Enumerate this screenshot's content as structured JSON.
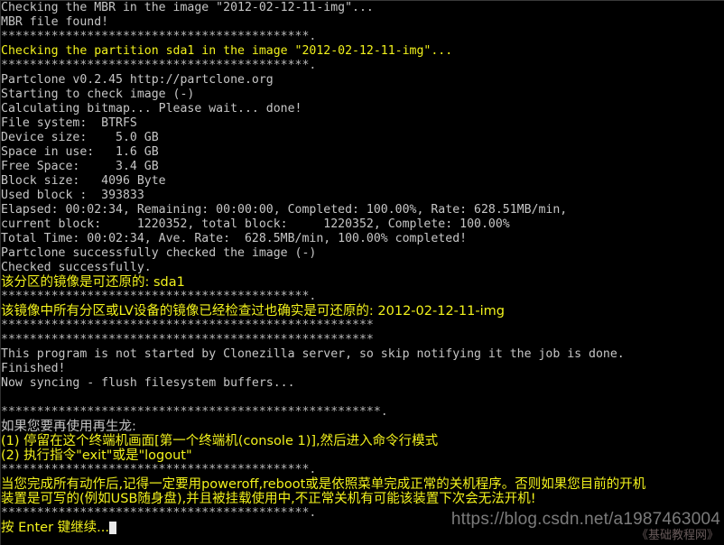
{
  "terminal": {
    "background_color": "#000000",
    "default_text_color": "#c6c6c6",
    "highlight_text_color": "#f2f21c",
    "cursor": "block-cursor",
    "separator_short": "*******************************************.",
    "separator_plain": "****************************************************",
    "separator_long": "*****************************************************.",
    "lines": [
      {
        "id": "l01",
        "color": "white",
        "text": "Checking the MBR in the image \"2012-02-12-11-img\"..."
      },
      {
        "id": "l02",
        "color": "white",
        "text": "MBR file found!"
      },
      {
        "id": "l03",
        "color": "stars",
        "text": "*******************************************."
      },
      {
        "id": "l04",
        "color": "yellow",
        "text": "Checking the partition sda1 in the image \"2012-02-12-11-img\"..."
      },
      {
        "id": "l05",
        "color": "stars",
        "text": "*******************************************."
      },
      {
        "id": "l06",
        "color": "white",
        "text": "Partclone v0.2.45 http://partclone.org"
      },
      {
        "id": "l07",
        "color": "white",
        "text": "Starting to check image (-)"
      },
      {
        "id": "l08",
        "color": "white",
        "text": "Calculating bitmap... Please wait... done!"
      },
      {
        "id": "l09",
        "color": "white",
        "text": "File system:  BTRFS"
      },
      {
        "id": "l10",
        "color": "white",
        "text": "Device size:    5.0 GB"
      },
      {
        "id": "l11",
        "color": "white",
        "text": "Space in use:   1.6 GB"
      },
      {
        "id": "l12",
        "color": "white",
        "text": "Free Space:     3.4 GB"
      },
      {
        "id": "l13",
        "color": "white",
        "text": "Block size:   4096 Byte"
      },
      {
        "id": "l14",
        "color": "white",
        "text": "Used block :  393833"
      },
      {
        "id": "l15",
        "color": "white",
        "text": "Elapsed: 00:02:34, Remaining: 00:00:00, Completed: 100.00%, Rate: 628.51MB/min,"
      },
      {
        "id": "l16",
        "color": "white",
        "text": "current block:     1220352, total block:     1220352, Complete: 100.00%"
      },
      {
        "id": "l17",
        "color": "white",
        "text": "Total Time: 00:02:34, Ave. Rate:  628.5MB/min, 100.00% completed!"
      },
      {
        "id": "l18",
        "color": "white",
        "text": "Partclone successfully checked the image (-)"
      },
      {
        "id": "l19",
        "color": "white",
        "text": "Checked successfully."
      },
      {
        "id": "l20",
        "color": "yellow",
        "cjk": true,
        "text": "该分区的镜像是可还原的: sda1"
      },
      {
        "id": "l21",
        "color": "stars",
        "text": "*******************************************."
      },
      {
        "id": "l22",
        "color": "yellow",
        "cjk": true,
        "text": "该镜像中所有分区或LV设备的镜像已经检查过也确实是可还原的: 2012-02-12-11-img"
      },
      {
        "id": "l23",
        "color": "stars",
        "text": "****************************************************"
      },
      {
        "id": "l24",
        "color": "stars",
        "text": "****************************************************"
      },
      {
        "id": "l25",
        "color": "white",
        "text": "This program is not started by Clonezilla server, so skip notifying it the job is done."
      },
      {
        "id": "l26",
        "color": "white",
        "text": "Finished!"
      },
      {
        "id": "l27",
        "color": "white",
        "text": "Now syncing - flush filesystem buffers..."
      },
      {
        "id": "l28",
        "color": "white",
        "text": ""
      },
      {
        "id": "l29",
        "color": "stars",
        "text": "*****************************************************."
      },
      {
        "id": "l30",
        "color": "white",
        "cjk": true,
        "text": "如果您要再使用再生龙:"
      },
      {
        "id": "l31",
        "color": "yellow",
        "cjk": true,
        "text": "(1) 停留在这个终端机画面[第一个终端机(console 1)],然后进入命令行模式"
      },
      {
        "id": "l32",
        "color": "yellow",
        "cjk": true,
        "text": "(2) 执行指令\"exit\"或是\"logout\""
      },
      {
        "id": "l33",
        "color": "stars",
        "text": "*******************************************."
      },
      {
        "id": "l34",
        "color": "yellow",
        "cjk": true,
        "text": "当您完成所有动作后,记得一定要用poweroff,reboot或是依照菜单完成正常的关机程序。否则如果您目前的开机"
      },
      {
        "id": "l35",
        "color": "yellow",
        "cjk": true,
        "text": "装置是可写的(例如USB随身盘),并且被挂载使用中,不正常关机有可能该装置下次会无法开机!"
      },
      {
        "id": "l36",
        "color": "stars",
        "text": "*******************************************."
      },
      {
        "id": "l37",
        "color": "yellow",
        "cjk": true,
        "prompt": true,
        "text": "按 Enter 键继续..."
      }
    ]
  },
  "watermark": {
    "url": "https://blog.csdn.net/a1987463004",
    "site_name": "《基础教程网》",
    "url_color": "#8c8c8c",
    "site_color": "#7a6a6a"
  }
}
